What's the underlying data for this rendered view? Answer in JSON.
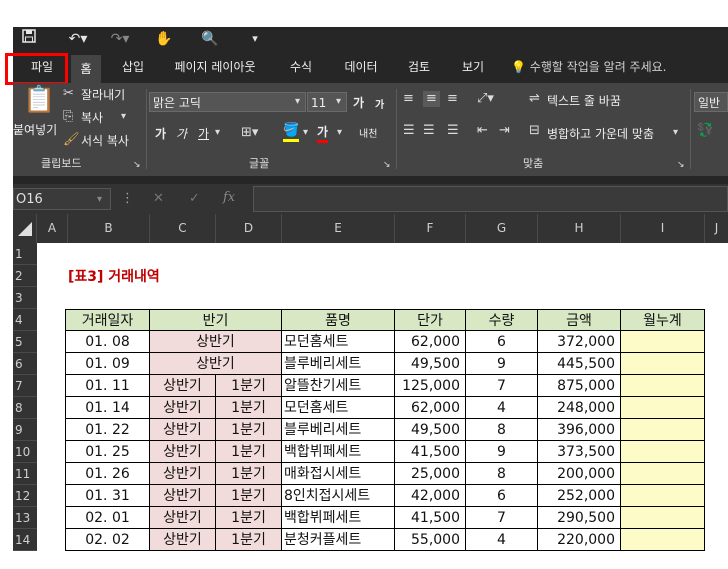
{
  "qat": {
    "icons": [
      "save-icon",
      "undo-icon",
      "redo-icon",
      "touch-mode-icon",
      "print-preview-icon",
      "customize-qat-icon"
    ]
  },
  "tabs": [
    {
      "label": "파일"
    },
    {
      "label": "홈"
    },
    {
      "label": "삽입"
    },
    {
      "label": "페이지 레이아웃"
    },
    {
      "label": "수식"
    },
    {
      "label": "데이터"
    },
    {
      "label": "검토"
    },
    {
      "label": "보기"
    }
  ],
  "tell_me": "수행할 작업을 알려 주세요.",
  "ribbon": {
    "clipboard": {
      "paste": "붙여넣기",
      "cut": "잘라내기",
      "copy": "복사",
      "format_painter": "서식 복사",
      "label": "클립보드"
    },
    "font": {
      "name": "맑은 고딕",
      "size": "11",
      "label": "글꼴",
      "bold": "가",
      "italic": "가",
      "underline": "가",
      "grow": "가",
      "shrink": "가",
      "font_color": "가",
      "phonetic": "내천"
    },
    "alignment": {
      "wrap": "텍스트 줄 바꿈",
      "merge": "병합하고 가운데 맞춤",
      "label": "맞춤"
    },
    "number": {
      "format": "일반"
    }
  },
  "formula_bar": {
    "name_box": "O16",
    "fx": "fx"
  },
  "columns": [
    "A",
    "B",
    "C",
    "D",
    "E",
    "F",
    "G",
    "H",
    "I",
    "J"
  ],
  "rows": [
    "1",
    "2",
    "3",
    "4",
    "5",
    "6",
    "7",
    "8",
    "9",
    "10",
    "11",
    "12",
    "13",
    "14"
  ],
  "sheet": {
    "title": "[표3] 거래내역",
    "headers": {
      "date": "거래일자",
      "half": "반기",
      "item": "품명",
      "price": "단가",
      "qty": "수량",
      "amount": "금액",
      "cumulative": "월누계"
    },
    "records": [
      {
        "date": "01. 08",
        "half": "상반기",
        "quarter": "",
        "item": "모던홈세트",
        "price": "62,000",
        "qty": "6",
        "amount": "372,000"
      },
      {
        "date": "01. 09",
        "half": "상반기",
        "quarter": "",
        "item": "블루베리세트",
        "price": "49,500",
        "qty": "9",
        "amount": "445,500"
      },
      {
        "date": "01. 11",
        "half": "상반기",
        "quarter": "1분기",
        "item": "알뜰찬기세트",
        "price": "125,000",
        "qty": "7",
        "amount": "875,000"
      },
      {
        "date": "01. 14",
        "half": "상반기",
        "quarter": "1분기",
        "item": "모던홈세트",
        "price": "62,000",
        "qty": "4",
        "amount": "248,000"
      },
      {
        "date": "01. 22",
        "half": "상반기",
        "quarter": "1분기",
        "item": "블루베리세트",
        "price": "49,500",
        "qty": "8",
        "amount": "396,000"
      },
      {
        "date": "01. 25",
        "half": "상반기",
        "quarter": "1분기",
        "item": "백합뷔페세트",
        "price": "41,500",
        "qty": "9",
        "amount": "373,500"
      },
      {
        "date": "01. 26",
        "half": "상반기",
        "quarter": "1분기",
        "item": "매화접시세트",
        "price": "25,000",
        "qty": "8",
        "amount": "200,000"
      },
      {
        "date": "01. 31",
        "half": "상반기",
        "quarter": "1분기",
        "item": "8인치접시세트",
        "price": "42,000",
        "qty": "6",
        "amount": "252,000"
      },
      {
        "date": "02. 01",
        "half": "상반기",
        "quarter": "1분기",
        "item": "백합뷔페세트",
        "price": "41,500",
        "qty": "7",
        "amount": "290,500"
      },
      {
        "date": "02. 02",
        "half": "상반기",
        "quarter": "1분기",
        "item": "분청커플세트",
        "price": "55,000",
        "qty": "4",
        "amount": "220,000"
      }
    ]
  },
  "colors": {
    "header_fill": "#d9e8c4",
    "half_fill": "#f2dcdb",
    "cumulative_fill": "#fdfcc8",
    "title_color": "#c00000",
    "highlight": "#ff0000"
  }
}
